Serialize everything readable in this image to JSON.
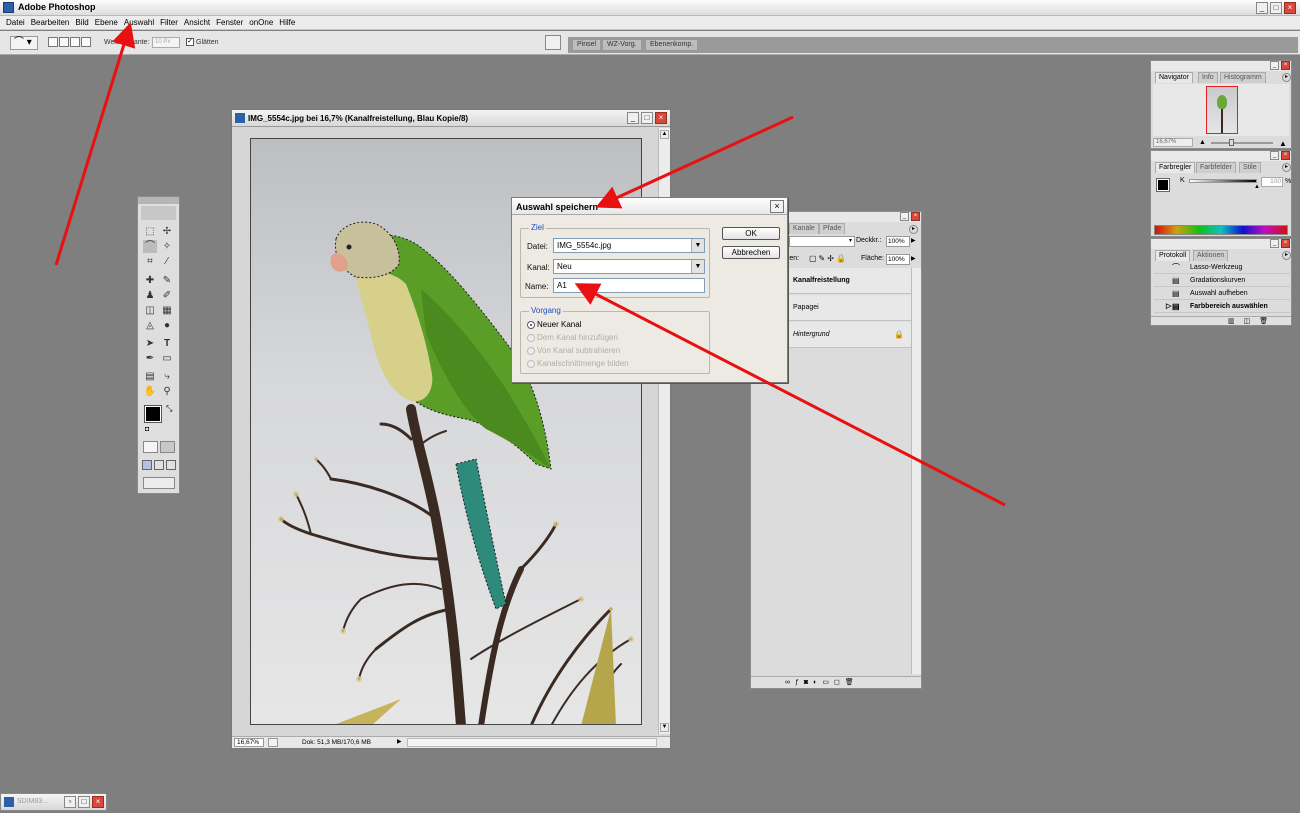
{
  "app": {
    "title": "Adobe Photoshop"
  },
  "menu": [
    "Datei",
    "Bearbeiten",
    "Bild",
    "Ebene",
    "Auswahl",
    "Filter",
    "Ansicht",
    "Fenster",
    "onOne",
    "Hilfe"
  ],
  "options": {
    "feather_label": "Weiche Kante:",
    "feather_value": "10 Px",
    "smooth_label": "Glätten",
    "well_tabs": [
      "Pinsel",
      "WZ-Vorg.",
      "Ebenenkomp."
    ]
  },
  "document": {
    "title": "IMG_5554c.jpg bei 16,7% (Kanalfreistellung, Blau Kopie/8)",
    "zoom": "16,67%",
    "doc_info": "Dok: 51,3 MB/170,6 MB"
  },
  "dialog": {
    "title": "Auswahl speichern",
    "target_legend": "Ziel",
    "file_label": "Datei:",
    "file_value": "IMG_5554c.jpg",
    "channel_label": "Kanal:",
    "channel_value": "Neu",
    "name_label": "Name:",
    "name_value": "A1",
    "operation_legend": "Vorgang",
    "options": [
      {
        "label": "Neuer Kanal",
        "selected": true,
        "enabled": true
      },
      {
        "label": "Dem Kanal hinzufügen",
        "selected": false,
        "enabled": false
      },
      {
        "label": "Von Kanal subtrahieren",
        "selected": false,
        "enabled": false
      },
      {
        "label": "Kanalschnittmenge bilden",
        "selected": false,
        "enabled": false
      }
    ],
    "ok_label": "OK",
    "cancel_label": "Abbrechen"
  },
  "layers_panel": {
    "tabs": [
      "Kanäle",
      "Pfade"
    ],
    "opacity_label": "Deckkr.:",
    "opacity_value": "100%",
    "lock_label": "ren:",
    "fill_label": "Fläche:",
    "fill_value": "100%",
    "layers": [
      {
        "name": "Kanalfreistellung",
        "bold": true
      },
      {
        "name": "Papagei",
        "bold": false
      },
      {
        "name": "Hintergrund",
        "bold": false,
        "italic": true
      }
    ]
  },
  "navigator_panel": {
    "tabs": [
      "Navigator",
      "Info",
      "Histogramm"
    ],
    "zoom": "16,67%"
  },
  "color_panel": {
    "tabs": [
      "Farbregler",
      "Farbfelder",
      "Stile"
    ],
    "channel": "K",
    "value": "100",
    "unit": "%"
  },
  "history_panel": {
    "tabs": [
      "Protokoll",
      "Aktionen"
    ],
    "items": [
      "Lasso-Werkzeug",
      "Gradationskurven",
      "Auswahl aufheben",
      "Farbbereich auswählen"
    ],
    "active_item": "Farbbereich auswählen"
  },
  "taskbar_window": {
    "title": "SDIM83..."
  },
  "colors": {
    "workspace": "#7f7f7f",
    "annotation": "#e81010",
    "dialog_bg": "#eceae3",
    "legend": "#1f4fbf"
  },
  "icons": [
    "photoshop-icon",
    "lasso-icon",
    "minimize-icon",
    "maximize-icon",
    "close-icon",
    "eye-icon",
    "lock-icon",
    "trash-icon"
  ]
}
